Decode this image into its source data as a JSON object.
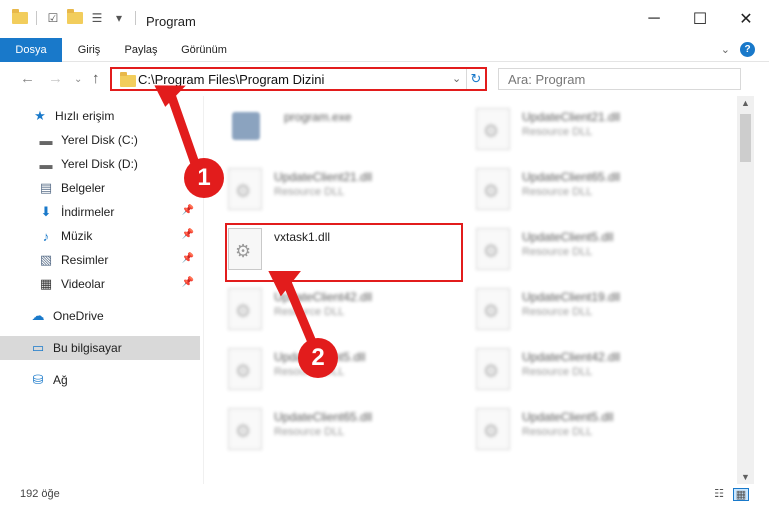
{
  "window": {
    "title": "Program",
    "minimize": "─",
    "maximize": "☐",
    "close": "✕"
  },
  "ribbon": {
    "tabs": [
      "Dosya",
      "Giriş",
      "Paylaş",
      "Görünüm"
    ],
    "help": "?"
  },
  "nav": {
    "address": "C:\\Program Files\\Program Dizini",
    "search_placeholder": "Ara: Program"
  },
  "sidebar": {
    "items": [
      {
        "label": "Hızlı erişim",
        "icon": "star-icon"
      },
      {
        "label": "Yerel Disk (C:)",
        "icon": "drive-icon"
      },
      {
        "label": "Yerel Disk (D:)",
        "icon": "drive-icon"
      },
      {
        "label": "Belgeler",
        "icon": "documents-icon"
      },
      {
        "label": "İndirmeler",
        "icon": "download-icon"
      },
      {
        "label": "Müzik",
        "icon": "music-icon"
      },
      {
        "label": "Resimler",
        "icon": "pictures-icon"
      },
      {
        "label": "Videolar",
        "icon": "videos-icon"
      },
      {
        "label": "OneDrive",
        "icon": "cloud-icon"
      },
      {
        "label": "Bu bilgisayar",
        "icon": "computer-icon"
      },
      {
        "label": "Ağ",
        "icon": "network-icon"
      }
    ]
  },
  "files": [
    {
      "name": "program.exe",
      "type": ""
    },
    {
      "name": "UpdateClient21.dll",
      "type": "Resource DLL"
    },
    {
      "name": "UpdateClient65.dll",
      "type": "Resource DLL"
    },
    {
      "name": "UpdateClient21.dll",
      "type": "Resource DLL"
    },
    {
      "name": "vxtask1.dll",
      "type": ""
    },
    {
      "name": "UpdateClient5.dll",
      "type": "Resource DLL"
    },
    {
      "name": "UpdateClient42.dll",
      "type": "Resource DLL"
    },
    {
      "name": "UpdateClient19.dll",
      "type": "Resource DLL"
    },
    {
      "name": "UpdateClient5.dll",
      "type": "Resource DLL"
    },
    {
      "name": "UpdateClient42.dll",
      "type": "Resource DLL"
    },
    {
      "name": "UpdateClient65.dll",
      "type": "Resource DLL"
    },
    {
      "name": "UpdateClient5.dll",
      "type": "Resource DLL"
    }
  ],
  "status": {
    "item_count": "192 öğe"
  },
  "annotations": {
    "step1": "1",
    "step2": "2",
    "color": "#e21c1c"
  },
  "colors": {
    "accent": "#1979ca",
    "highlight_border": "#e21c1c"
  }
}
